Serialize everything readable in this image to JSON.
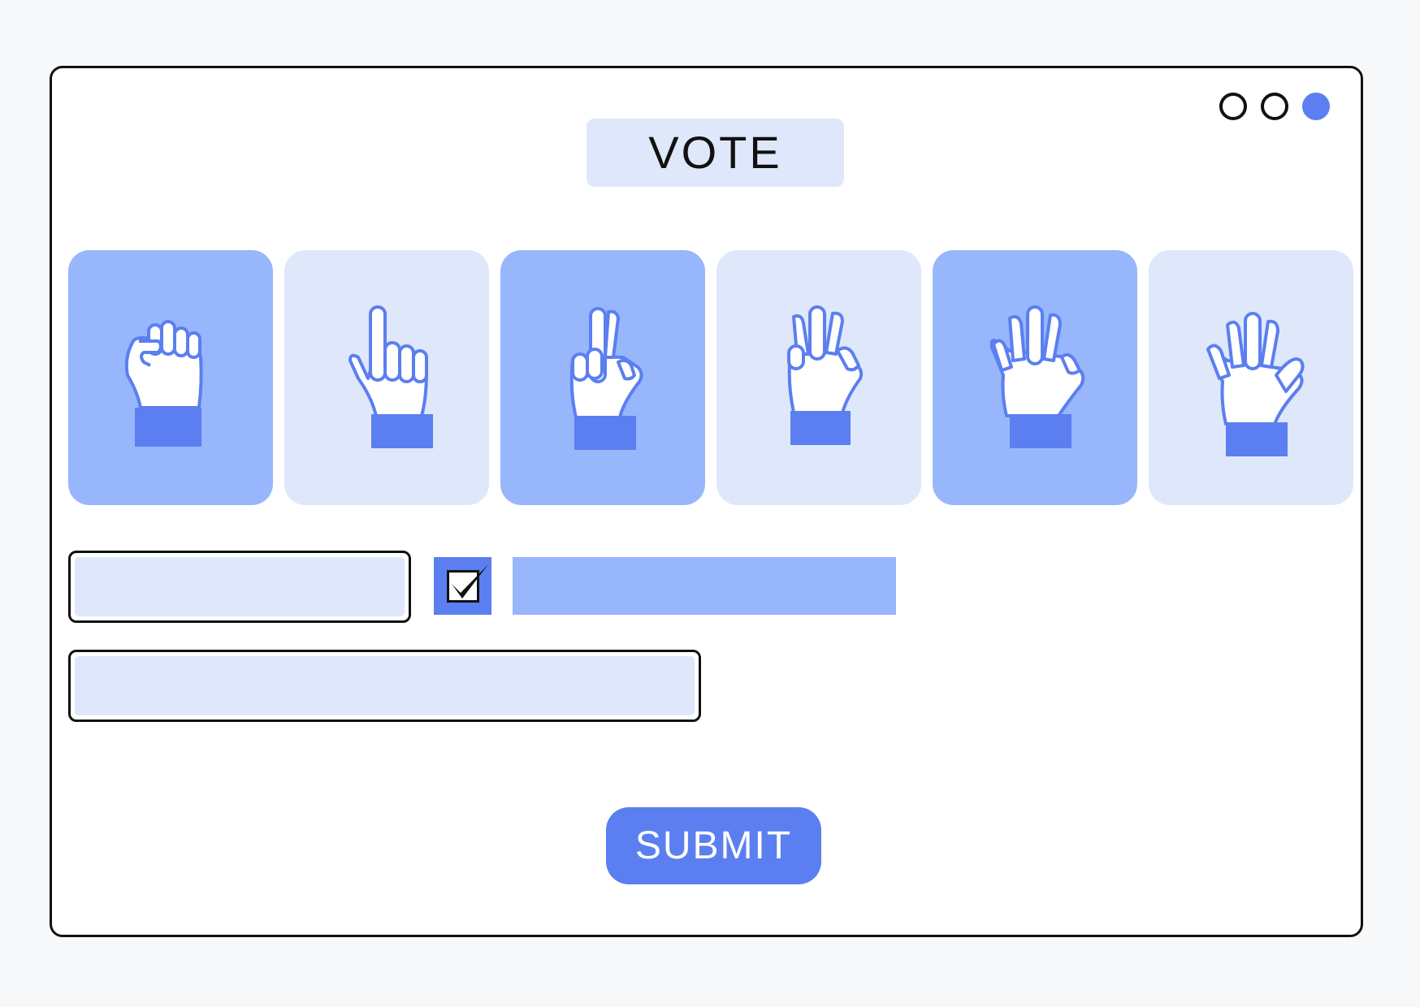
{
  "window": {
    "controls": [
      "circle-empty-icon",
      "circle-empty-icon",
      "circle-filled-icon"
    ]
  },
  "title": "VOTE",
  "vote_options": [
    {
      "icon": "fist-icon",
      "fingers": 0,
      "style": "dark"
    },
    {
      "icon": "one-finger-hand-icon",
      "fingers": 1,
      "style": "light"
    },
    {
      "icon": "two-fingers-hand-icon",
      "fingers": 2,
      "style": "dark"
    },
    {
      "icon": "three-fingers-hand-icon",
      "fingers": 3,
      "style": "light"
    },
    {
      "icon": "four-fingers-hand-icon",
      "fingers": 4,
      "style": "dark"
    },
    {
      "icon": "five-fingers-hand-icon",
      "fingers": 5,
      "style": "light"
    }
  ],
  "form": {
    "checkbox_checked": true
  },
  "submit_label": "SUBMIT",
  "colors": {
    "accent": "#5b7ff0",
    "card_dark": "#98b6fc",
    "card_light": "#dfe7fb"
  }
}
